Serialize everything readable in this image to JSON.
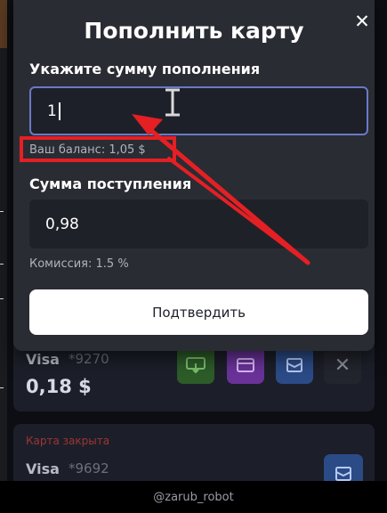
{
  "modal": {
    "title": "Пополнить карту",
    "close_symbol": "✕",
    "amount_label": "Укажите сумму пополнения",
    "amount_value": "1",
    "balance_hint": "Ваш баланс: 1,05 $",
    "received_label": "Сумма поступления",
    "received_value": "0,98",
    "commission_hint": "Комиссия: 1.5 %",
    "confirm_label": "Подтвердить"
  },
  "cards": [
    {
      "brand": "Visa",
      "number": "*9270",
      "amount": "0,18 $",
      "actions": [
        "card-withdraw-icon",
        "card-icon",
        "envelope-icon",
        "close-icon"
      ],
      "close_symbol": "✕"
    },
    {
      "status": "Карта закрыта",
      "brand": "Visa",
      "number": "*9692",
      "actions": [
        "envelope-icon"
      ]
    }
  ],
  "watermark": "@zarub_robot",
  "colors": {
    "modal_bg": "#2a2c33",
    "input_focus_border": "#6b79c9",
    "annotation_red": "#e42024",
    "card_closed_red": "#9e3535"
  }
}
